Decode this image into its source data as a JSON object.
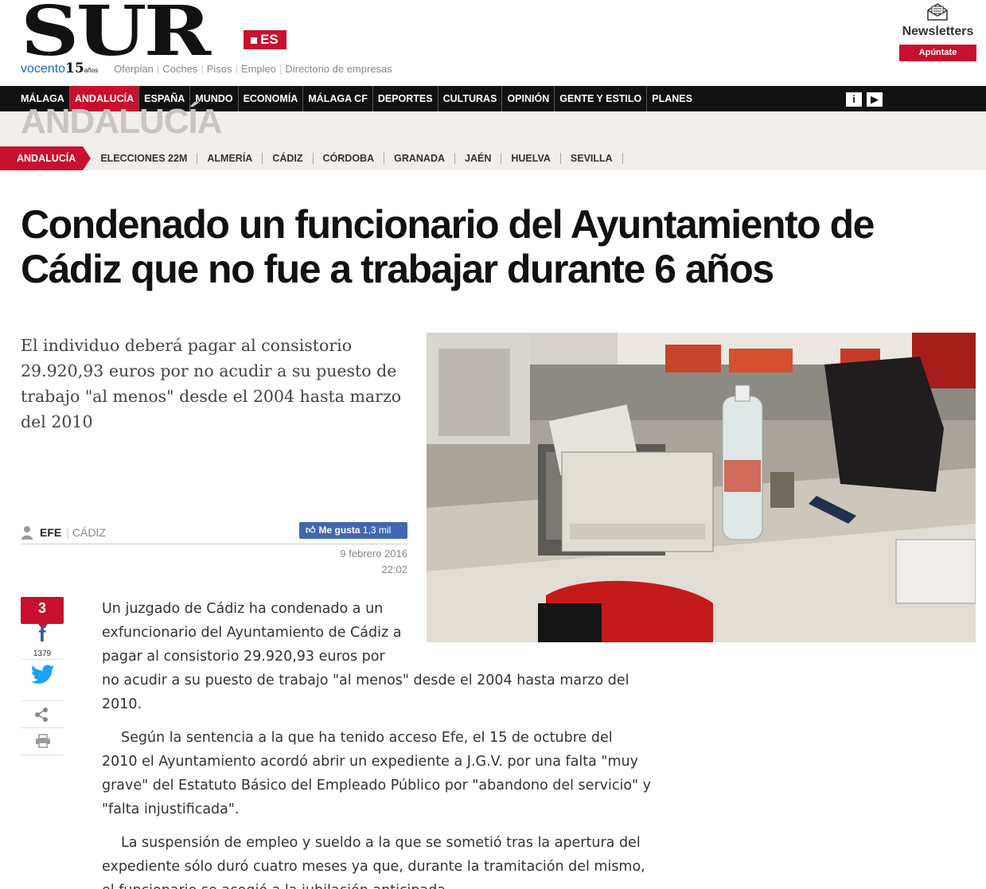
{
  "header": {
    "logo_text": "SUR",
    "logo_suffix": "ES",
    "vocento_text": "vocento",
    "vocento_years": "15",
    "vocento_years_small": "años",
    "top_links": [
      "Oferplan",
      "Coches",
      "Pisos",
      "Empleo",
      "Directorio de empresas"
    ],
    "newsletters_title": "Newsletters",
    "newsletters_button": "Apúntate"
  },
  "main_nav": {
    "items": [
      "MÁLAGA",
      "ANDALUCÍA",
      "ESPAÑA",
      "MUNDO",
      "ECONOMÍA",
      "MÁLAGA CF",
      "DEPORTES",
      "CULTURAS",
      "OPINIÓN",
      "GENTE Y ESTILO",
      "PLANES"
    ],
    "active_index": 1
  },
  "section": {
    "title": "ANDALUCÍA",
    "subnav_first": "ANDALUCÍA",
    "subnav_items": [
      "ELECCIONES 22M",
      "ALMERÍA",
      "CÁDIZ",
      "CÓRDOBA",
      "GRANADA",
      "JAÉN",
      "HUELVA",
      "SEVILLA"
    ]
  },
  "article": {
    "headline_line1": "Condenado un funcionario del Ayuntamiento de",
    "headline_line2": "Cádiz que no fue a trabajar durante 6 años",
    "lead": "El individuo deberá pagar al consistorio 29.920,93 euros por no acudir a su puesto de trabajo \"al menos\" desde el 2004 hasta marzo del 2010",
    "author": "EFE",
    "place": "CÁDIZ",
    "like_label": "Me gusta",
    "like_count": "1,3 mil",
    "date": "9 febrero 2016",
    "time": "22:02",
    "share_count": "3",
    "facebook_count": "1379",
    "p1_line1": "Un juzgado de Cádiz ha condenado a un",
    "p1_line2": "exfuncionario del Ayuntamiento de Cádiz a",
    "p1_line3": "pagar al consistorio 29.920,93 euros por",
    "p1_rest": "no acudir a su puesto de trabajo \"al menos\" desde el 2004 hasta marzo del 2010.",
    "p2": "Según la sentencia a la que ha tenido acceso Efe, el 15 de octubre del 2010 el Ayuntamiento acordó abrir un expediente a J.G.V. por una falta \"muy grave\" del Estatuto Básico del Empleado Público por \"abandono del servicio\" y \"falta injustificada\".",
    "p3": "La suspensión de empleo y sueldo a la que se sometió tras la apertura del expediente sólo duró cuatro meses ya que, durante la tramitación del mismo, el funcionario se acogió a la jubilación anticipada."
  }
}
